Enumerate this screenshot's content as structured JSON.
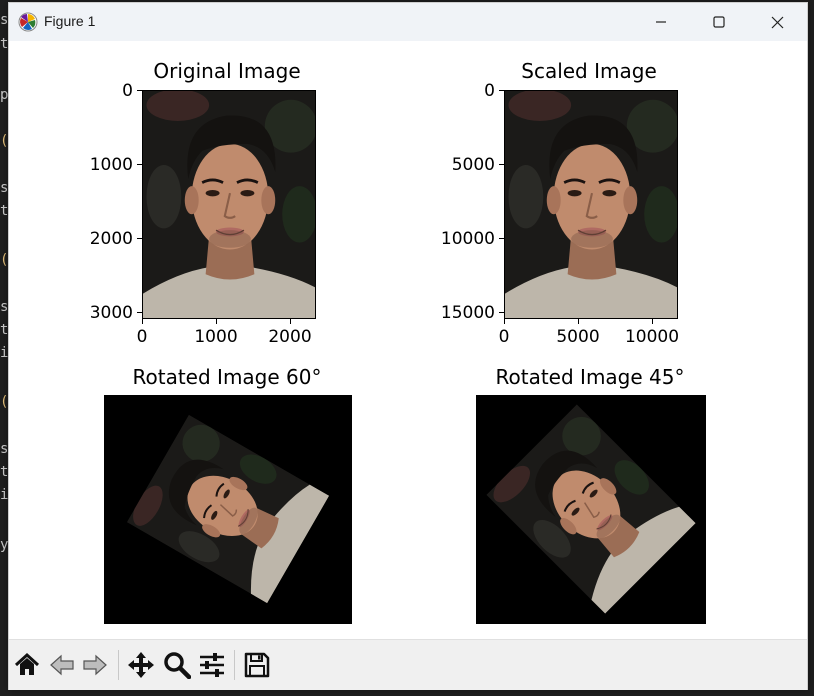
{
  "window": {
    "title": "Figure 1",
    "icons": [
      "matplotlib-app-icon",
      "minimize-icon",
      "maximize-icon",
      "close-icon"
    ]
  },
  "figure": {
    "subplots": [
      {
        "title": "Original Image",
        "yticks": [
          "0",
          "1000",
          "2000",
          "3000"
        ],
        "xticks": [
          "0",
          "1000",
          "2000"
        ],
        "axes_visible": true
      },
      {
        "title": "Scaled Image",
        "yticks": [
          "0",
          "5000",
          "10000",
          "15000"
        ],
        "xticks": [
          "0",
          "5000",
          "10000"
        ],
        "axes_visible": true
      },
      {
        "title": "Rotated Image 60°",
        "axes_visible": false,
        "rotation_degrees": 60
      },
      {
        "title": "Rotated Image 45°",
        "axes_visible": false,
        "rotation_degrees": 45
      }
    ]
  },
  "toolbar": {
    "buttons": [
      "home-icon",
      "back-icon",
      "forward-icon",
      "pan-icon",
      "zoom-icon",
      "configure-subplots-icon",
      "save-icon"
    ]
  },
  "background_terminal": {
    "fragments": [
      "s",
      "t",
      "p",
      "(",
      "s",
      "t",
      "(",
      "s",
      "t",
      "i",
      "(",
      "s",
      "t",
      "i",
      "y"
    ]
  }
}
